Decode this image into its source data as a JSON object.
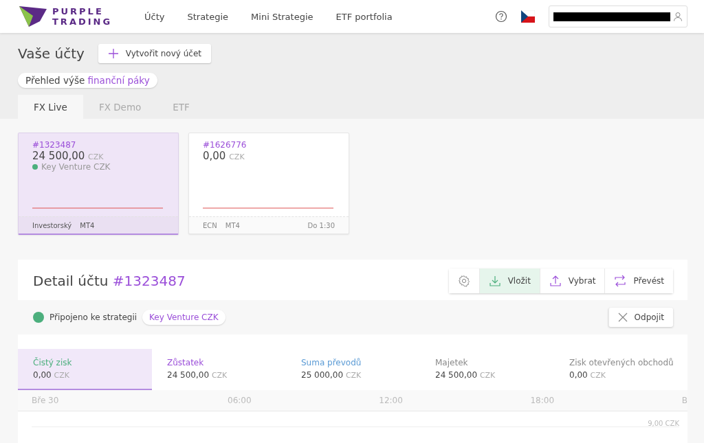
{
  "header": {
    "logo": [
      "PURPLE",
      "TRADING"
    ],
    "nav": [
      {
        "label": "Účty"
      },
      {
        "label": "Strategie"
      },
      {
        "label": "Mini Strategie"
      },
      {
        "label": "ETF portfolia"
      }
    ]
  },
  "page": {
    "title": "Vaše účty",
    "create_button": "Vytvořit nový účet",
    "leverage_pill": "Přehled výše **finanční páky**"
  },
  "tabs": [
    {
      "label": "FX Live",
      "selected": true
    },
    {
      "label": "FX Demo",
      "selected": false
    },
    {
      "label": "ETF",
      "selected": false
    }
  ],
  "accounts": [
    {
      "number": "#1323487",
      "amount": "24 500,00",
      "currency": "CZK",
      "strategy": "Key Venture CZK",
      "selected": true,
      "footer": [
        "Investorský",
        "MT4"
      ]
    },
    {
      "number": "#1626776",
      "amount": "0,00",
      "currency": "CZK",
      "selected": false,
      "footer": [
        "ECN",
        "MT4"
      ],
      "leverage": "Do 1:30"
    }
  ],
  "detail": {
    "title": "Detail účtu",
    "number": "#1323487",
    "actions": [
      {
        "kind": "settings"
      },
      {
        "kind": "deposit",
        "label": "Vložit",
        "selected": true
      },
      {
        "kind": "withdraw",
        "label": "Vybrat",
        "selected": false
      },
      {
        "kind": "transfer",
        "label": "Převést",
        "selected": false
      }
    ],
    "connected": "Připojeno ke strategii",
    "strategy": "Key Venture CZK",
    "disconnect": "Odpojit",
    "metrics": [
      {
        "label": "Čistý zisk",
        "value": "0,00",
        "currency": "CZK",
        "color": "#4caf7d",
        "selected": true
      },
      {
        "label": "Zůstatek",
        "value": "24 500,00",
        "currency": "CZK",
        "color": "#9b4fd9",
        "selected": false
      },
      {
        "label": "Suma převodů",
        "value": "25 000,00",
        "currency": "CZK",
        "color": "#5b9bd5",
        "selected": false
      },
      {
        "label": "Majetek",
        "value": "24 500,00",
        "currency": "CZK",
        "color": "#8a8a8a",
        "selected": false
      },
      {
        "label": "Zisk otevřených obchodů",
        "value": "0,00",
        "currency": "CZK",
        "color": "#8a8a8a",
        "selected": false
      }
    ],
    "time_axis": [
      "Bře 30",
      "06:00",
      "12:00",
      "18:00",
      "B"
    ],
    "y_label": "9,00 CZK"
  }
}
